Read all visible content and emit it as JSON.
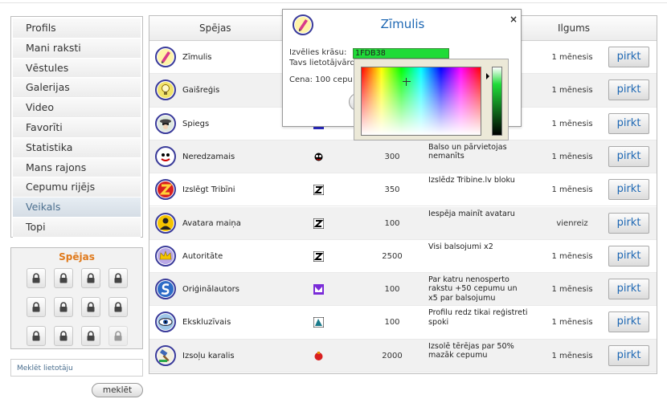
{
  "menu": {
    "items": [
      {
        "label": "Profils"
      },
      {
        "label": "Mani raksti"
      },
      {
        "label": "Vēstules"
      },
      {
        "label": "Galerijas"
      },
      {
        "label": "Video"
      },
      {
        "label": "Favorīti"
      },
      {
        "label": "Statistika"
      },
      {
        "label": "Mans rajons"
      },
      {
        "label": "Cepumu rijējs"
      },
      {
        "label": "Veikals",
        "active": true
      },
      {
        "label": "Topi"
      }
    ]
  },
  "abilities_box": {
    "title": "Spējas",
    "lock_icon": "padlock-icon",
    "slots_locked": 11,
    "slots_empty": 1
  },
  "search": {
    "placeholder": "Meklēt lietotāju",
    "button_label": "meklēt"
  },
  "table": {
    "headers": {
      "ability": "Spējas",
      "duration": "Ilgums"
    },
    "buy_label": "pirkt",
    "rows": [
      {
        "name": "Zīmulis",
        "icon": "pencil-icon",
        "price": "",
        "description": "",
        "duration": "1 mēnesis"
      },
      {
        "name": "Gaišreģis",
        "icon": "lightbulb-icon",
        "price": "",
        "description": "",
        "duration": "1 mēnesis"
      },
      {
        "name": "Spiegs",
        "icon": "spy-icon",
        "price": "",
        "description": "",
        "duration": "1 mēnesis"
      },
      {
        "name": "Neredzamais",
        "icon": "ghost-icon",
        "price": "300",
        "description": "Balso un pārvietojas nemanīts",
        "duration": "1 mēnesis"
      },
      {
        "name": "Izslēgt Tribīni",
        "icon": "z-icon",
        "price": "350",
        "description": "Izslēdz Tribine.lv bloku",
        "duration": "1 mēnesis"
      },
      {
        "name": "Avatara maiņa",
        "icon": "avatar-icon",
        "price": "100",
        "description": "Iespēja mainīt avataru",
        "duration": "vienreiz"
      },
      {
        "name": "Autoritāte",
        "icon": "crown-icon",
        "price": "2500",
        "description": "Visi balsojumi x2",
        "duration": "1 mēnesis"
      },
      {
        "name": "Oriģinālautors",
        "icon": "s-badge-icon",
        "price": "100",
        "description": "Par katru nenosperto rakstu +50 cepumu un x5 par balsojumu",
        "duration": "1 mēnesis"
      },
      {
        "name": "Ekskluzīvais",
        "icon": "eye-icon",
        "price": "100",
        "description": "Profilu redz tikai reģistreti spoki",
        "duration": "1 mēnesis"
      },
      {
        "name": "Izsoļu karalis",
        "icon": "gavel-icon",
        "price": "2000",
        "description": "Izsolē tērējas par 50% mazāk cepumu",
        "duration": "1 mēnesis"
      }
    ]
  },
  "dialog": {
    "title": "Zīmulis",
    "close": "×",
    "color_label": "Izvēlies krāsu:",
    "color_value": "1FDB38",
    "line2": "Tavs lietotājvārd",
    "price_text": "Cena: 100 cepu"
  },
  "colors": {
    "accent": "#1d67b3",
    "orange": "#e07a1c",
    "selected_color": "#1fdb38"
  }
}
